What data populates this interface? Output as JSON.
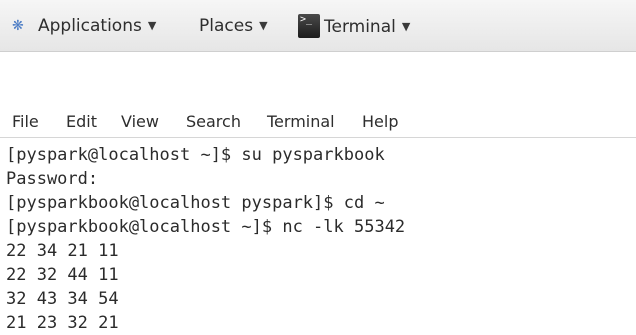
{
  "topbar": {
    "applications_label": "Applications",
    "places_label": "Places",
    "terminal_label": "Terminal",
    "caret": "▼"
  },
  "menubar": {
    "file": "File",
    "edit": "Edit",
    "view": "View",
    "search": "Search",
    "terminal": "Terminal",
    "help": "Help"
  },
  "terminal": {
    "lines": [
      "[pyspark@localhost ~]$ su pysparkbook",
      "Password:",
      "[pysparkbook@localhost pyspark]$ cd ~",
      "[pysparkbook@localhost ~]$ nc -lk 55342",
      "22 34 21 11",
      "22 32 44 11",
      "32 43 34 54",
      "21 23 32 21"
    ]
  },
  "icons": {
    "applications": "gnome-foot-icon",
    "terminal_app": "terminal-icon"
  }
}
